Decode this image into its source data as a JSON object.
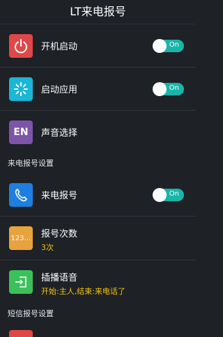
{
  "header": {
    "title": "LT来电报号"
  },
  "rows": {
    "boot": {
      "label": "开机启动",
      "toggle": "On",
      "color": "#e04848",
      "icon": "power-icon"
    },
    "launch": {
      "label": "启动应用",
      "toggle": "On",
      "color": "#1cb6d6",
      "icon": "spinner-icon"
    },
    "voice": {
      "label": "声音选择",
      "icon_text": "EN",
      "color": "#7c55a8"
    }
  },
  "sections": {
    "call": "来电报号设置",
    "sms": "短信报号设置"
  },
  "call_rows": {
    "announce": {
      "label": "来电报号",
      "toggle": "On",
      "color": "#1e7fe0",
      "icon": "phone-icon"
    },
    "count": {
      "label": "报号次数",
      "value": "3次",
      "icon_text": "123…",
      "color": "#e8a23e"
    },
    "insert": {
      "label": "插播语音",
      "value": "开始:主人,结束:来电话了",
      "color": "#3cc05a",
      "icon": "enter-icon"
    }
  }
}
